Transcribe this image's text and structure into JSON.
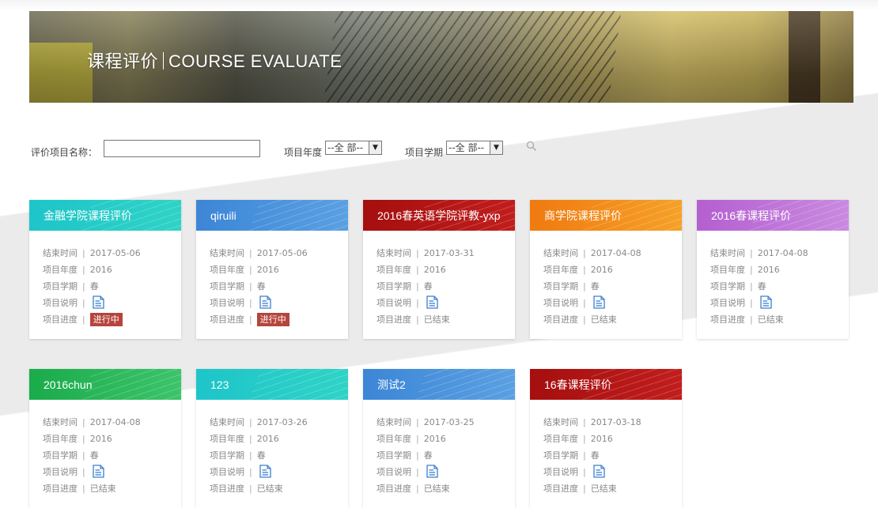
{
  "banner": {
    "title_cn": "课程评价",
    "title_en": "COURSE EVALUATE"
  },
  "search": {
    "name_label": "评价项目名称：",
    "name_value": "",
    "year_label": "项目年度",
    "year_selected": "--全 部--",
    "term_label": "项目学期",
    "term_selected": "--全 部--",
    "icon": "search-icon"
  },
  "labels": {
    "end_time": "结束时间",
    "year": "项目年度",
    "term": "项目学期",
    "desc": "项目说明",
    "progress": "项目进度",
    "sep": "|"
  },
  "cards": [
    {
      "title": "金融学院课程评价",
      "end": "2017-05-06",
      "year": "2016",
      "term": "春",
      "status": "进行中",
      "color": "#1ec5c9"
    },
    {
      "title": "qiruili",
      "end": "2017-05-06",
      "year": "2016",
      "term": "春",
      "status": "进行中",
      "color": "#3c86d6"
    },
    {
      "title": "2016春英语学院评教-yxp",
      "end": "2017-03-31",
      "year": "2016",
      "term": "春",
      "status": "已结束",
      "color": "#a50f0f"
    },
    {
      "title": "商学院课程评价",
      "end": "2017-04-08",
      "year": "2016",
      "term": "春",
      "status": "已结束",
      "color": "#f07a10"
    },
    {
      "title": "2016春课程评价",
      "end": "2017-04-08",
      "year": "2016",
      "term": "春",
      "status": "已结束",
      "color": "#b45fd0"
    },
    {
      "title": "2016chun",
      "end": "2017-04-08",
      "year": "2016",
      "term": "春",
      "status": "已结束",
      "color": "#1aab4a"
    },
    {
      "title": "123",
      "end": "2017-03-26",
      "year": "2016",
      "term": "春",
      "status": "已结束",
      "color": "#1ec5c9"
    },
    {
      "title": "测试2",
      "end": "2017-03-25",
      "year": "2016",
      "term": "春",
      "status": "已结束",
      "color": "#3c86d6"
    },
    {
      "title": "16春课程评价",
      "end": "2017-03-18",
      "year": "2016",
      "term": "春",
      "status": "已结束",
      "color": "#a50f0f"
    }
  ]
}
